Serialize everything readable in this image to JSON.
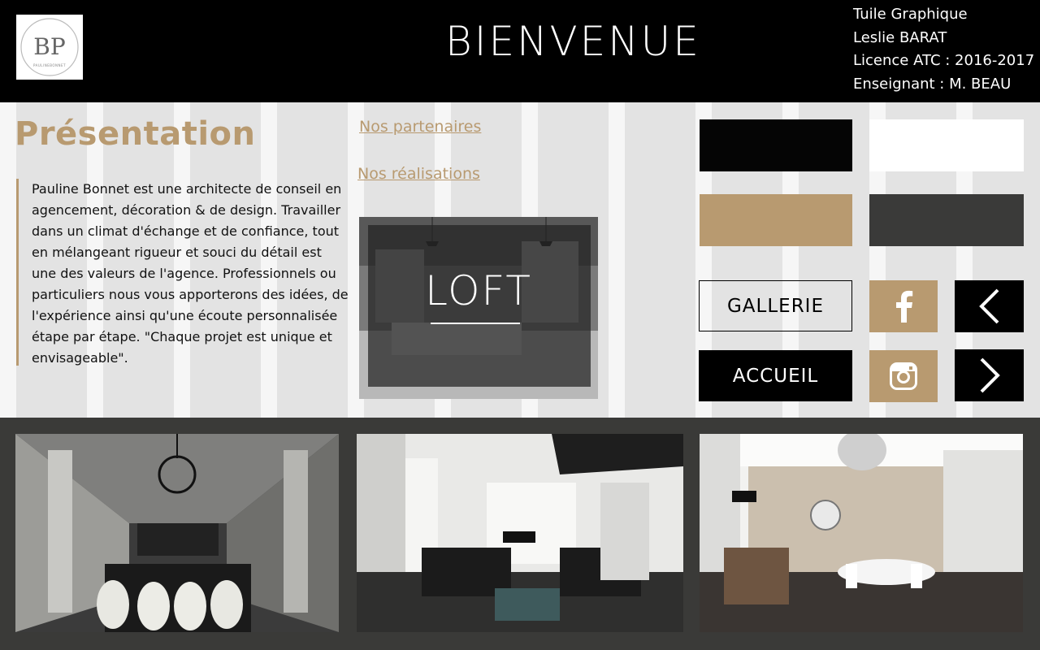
{
  "header": {
    "logo_label": "BP",
    "logo_caption": "PAULINEBONNET",
    "title": "BIENVENUE",
    "credits": [
      "Tuile Graphique",
      "Leslie BARAT",
      "Licence ATC : 2016-2017",
      "Enseignant : M. BEAU"
    ]
  },
  "presentation": {
    "title": "Présentation",
    "text": "Pauline Bonnet est une architecte de conseil en agencement, décoration & de design. Travailler dans un climat d'échange et de confiance, tout en mélangeant rigueur et souci du détail est une des valeurs de l'agence. Professionnels ou particuliers nous vous apporterons des idées, de l'expérience ainsi qu'une écoute personnalisée étape par étape. \"Chaque projet est unique et envisageable\"."
  },
  "links": {
    "partners": "Nos partenaires",
    "realisations": "Nos réalisations"
  },
  "feature": {
    "title": "LOFT"
  },
  "palette": {
    "black": "#050505",
    "white": "#ffffff",
    "gold": "#b89a70",
    "dark_gray": "#3a3a39"
  },
  "buttons": {
    "gallery": "GALLERIE",
    "home": "ACCUEIL"
  },
  "social": {
    "facebook": "facebook-icon",
    "instagram": "instagram-icon"
  },
  "navigation": {
    "prev": "chevron-left-icon",
    "next": "chevron-right-icon"
  },
  "photos": [
    "dining-room-photo",
    "living-room-photo",
    "salon-photo"
  ]
}
